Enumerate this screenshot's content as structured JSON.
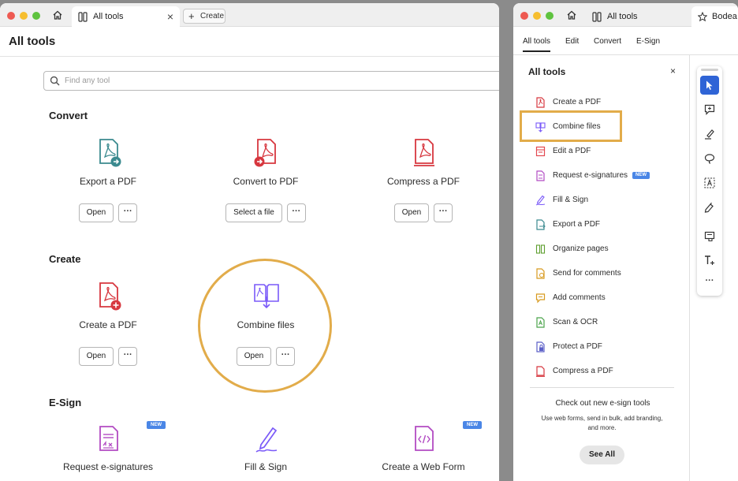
{
  "left_window": {
    "tab": {
      "label": "All tools",
      "close": "×"
    },
    "create_button": {
      "plus": "+",
      "label": "Create"
    },
    "page_title": "All tools",
    "search": {
      "placeholder": "Find any tool"
    },
    "sections": {
      "convert": {
        "heading": "Convert",
        "cards": [
          {
            "name": "Export a PDF",
            "button": "Open",
            "more": "···"
          },
          {
            "name": "Convert to PDF",
            "button": "Select a file",
            "more": "···"
          },
          {
            "name": "Compress a PDF",
            "button": "Open",
            "more": "···"
          }
        ]
      },
      "create": {
        "heading": "Create",
        "cards": [
          {
            "name": "Create a PDF",
            "button": "Open",
            "more": "···"
          },
          {
            "name": "Combine files",
            "button": "Open",
            "more": "···"
          }
        ]
      },
      "esign": {
        "heading": "E-Sign",
        "cards": [
          {
            "name": "Request e-signatures",
            "badge": "NEW"
          },
          {
            "name": "Fill & Sign"
          },
          {
            "name": "Create a Web Form",
            "badge": "NEW"
          }
        ]
      }
    }
  },
  "right_window": {
    "tab": {
      "label": "All tools",
      "next_tab_label": "Bodea"
    },
    "subtabs": [
      "All tools",
      "Edit",
      "Convert",
      "E-Sign"
    ],
    "panel_title": "All tools",
    "panel_close": "×",
    "items": [
      {
        "label": "Create a PDF",
        "icon": "create-pdf-icon"
      },
      {
        "label": "Combine files",
        "icon": "combine-files-icon"
      },
      {
        "label": "Edit a PDF",
        "icon": "edit-pdf-icon"
      },
      {
        "label": "Request e-signatures",
        "icon": "request-esign-icon",
        "badge": "NEW"
      },
      {
        "label": "Fill & Sign",
        "icon": "fill-sign-icon"
      },
      {
        "label": "Export a PDF",
        "icon": "export-pdf-icon"
      },
      {
        "label": "Organize pages",
        "icon": "organize-pages-icon"
      },
      {
        "label": "Send for comments",
        "icon": "send-comments-icon"
      },
      {
        "label": "Add comments",
        "icon": "add-comments-icon"
      },
      {
        "label": "Scan & OCR",
        "icon": "scan-ocr-icon"
      },
      {
        "label": "Protect a PDF",
        "icon": "protect-pdf-icon"
      },
      {
        "label": "Compress a PDF",
        "icon": "compress-pdf-icon"
      }
    ],
    "promo": {
      "title": "Check out new e-sign tools",
      "text": "Use web forms, send in bulk, add branding, and more.",
      "button": "See All"
    },
    "toolbar_more": "···"
  },
  "colors": {
    "highlight": "#e2ac4a",
    "accent_blue": "#2f64d6",
    "badge_blue": "#4a86e6",
    "pdf_red": "#d7373f",
    "combine_purple": "#7a5af8",
    "export_teal": "#3b8a8f"
  }
}
